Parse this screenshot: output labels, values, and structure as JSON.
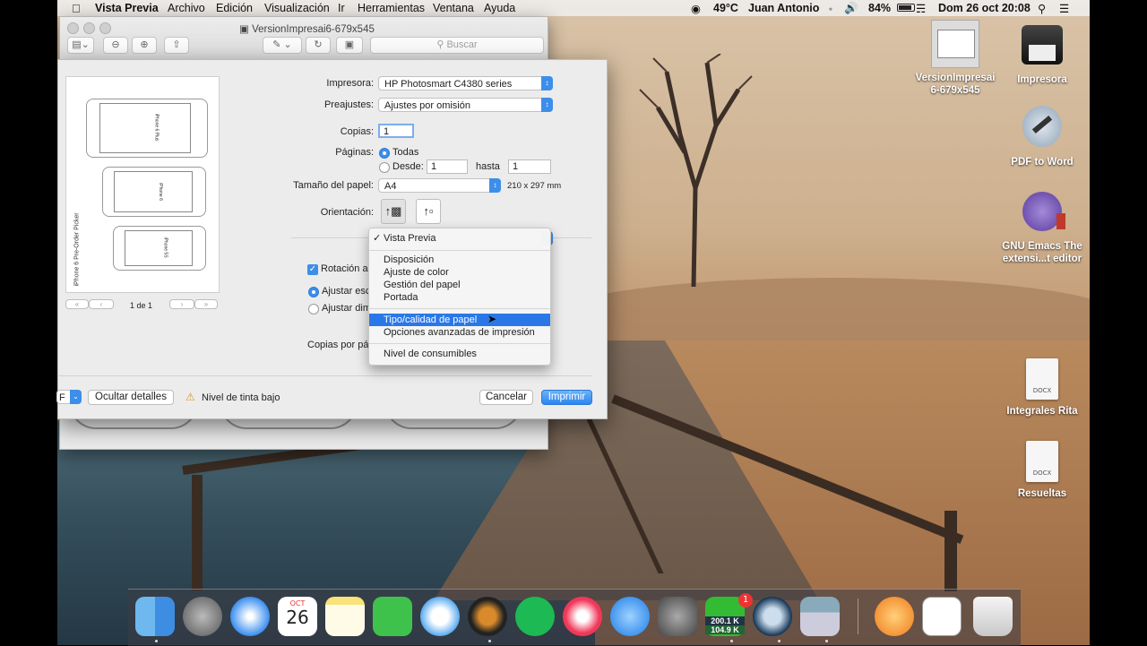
{
  "menubar": {
    "app_name": "Vista Previa",
    "items": [
      "Archivo",
      "Edición",
      "Visualización",
      "Ir",
      "Herramientas",
      "Ventana",
      "Ayuda"
    ],
    "temperature": "49°C",
    "user": "Juan Antonio",
    "battery": "84%",
    "clock": "Dom 26 oct  20:08"
  },
  "desktop_icons": [
    {
      "label_line1": "VersionImpresai",
      "label_line2": "6-679x545",
      "icon": "image-file-icon"
    },
    {
      "label_line1": "Impresora",
      "label_line2": "",
      "icon": "printer-icon"
    },
    {
      "label_line1": "PDF to Word",
      "label_line2": "",
      "icon": "pdf-to-word-app-icon"
    },
    {
      "label_line1": "GNU Emacs The",
      "label_line2": "extensi...t editor",
      "icon": "emacs-icon"
    },
    {
      "label_line1": "Integrales Rita",
      "label_line2": "",
      "icon": "docx-file-icon",
      "badge": "DOCX"
    },
    {
      "label_line1": "Resueltas",
      "label_line2": "",
      "icon": "docx-file-icon",
      "badge": "DOCX"
    }
  ],
  "preview_window": {
    "title": "VersionImpresai6-679x545",
    "search_placeholder": "Buscar"
  },
  "print_dialog": {
    "printer_label": "Impresora:",
    "printer_value": "HP Photosmart C4380 series",
    "presets_label": "Preajustes:",
    "presets_value": "Ajustes por omisión",
    "copies_label": "Copias:",
    "copies_value": "1",
    "pages_label": "Páginas:",
    "pages_all": "Todas",
    "pages_from": "Desde:",
    "pages_from_value": "1",
    "pages_to": "hasta",
    "pages_to_value": "1",
    "paper_size_label": "Tamaño del papel:",
    "paper_size_value": "A4",
    "paper_size_dims": "210 x 297 mm",
    "orientation_label": "Orientación:",
    "rotation_label": "Rotación a",
    "scale_fit_label": "Ajustar esc",
    "scale_size_label": "Ajustar dim",
    "copies_per_page_label": "Copias por pá",
    "page_counter": "1 de 1",
    "pdf_label": "F",
    "hide_details_button": "Ocultar detalles",
    "low_ink_warning": "Nivel de tinta bajo",
    "cancel_button": "Cancelar",
    "print_button": "Imprimir"
  },
  "thumbnail": {
    "vertical_title": "iPhone 6 Pre-Order Picker",
    "phone_labels": [
      "iPhone 6 Plus",
      "iPhone 6",
      "iPhone 5S"
    ]
  },
  "dropdown_menu": {
    "checked_item": "Vista Previa",
    "group1": [
      "Disposición",
      "Ajuste de color",
      "Gestión del papel",
      "Portada"
    ],
    "group2": [
      "Tipo/calidad de papel",
      "Opciones avanzadas de impresión"
    ],
    "selected_item": "Tipo/calidad de papel",
    "group3": [
      "Nivel de consumibles"
    ]
  },
  "dock": {
    "calendar_month": "OCT",
    "calendar_day": "26",
    "net_up": "200.1 K",
    "net_down": "104.9 K",
    "badge_count": "1"
  },
  "colors": {
    "accent": "#2a78e8",
    "menubar": "#eeeeee"
  }
}
